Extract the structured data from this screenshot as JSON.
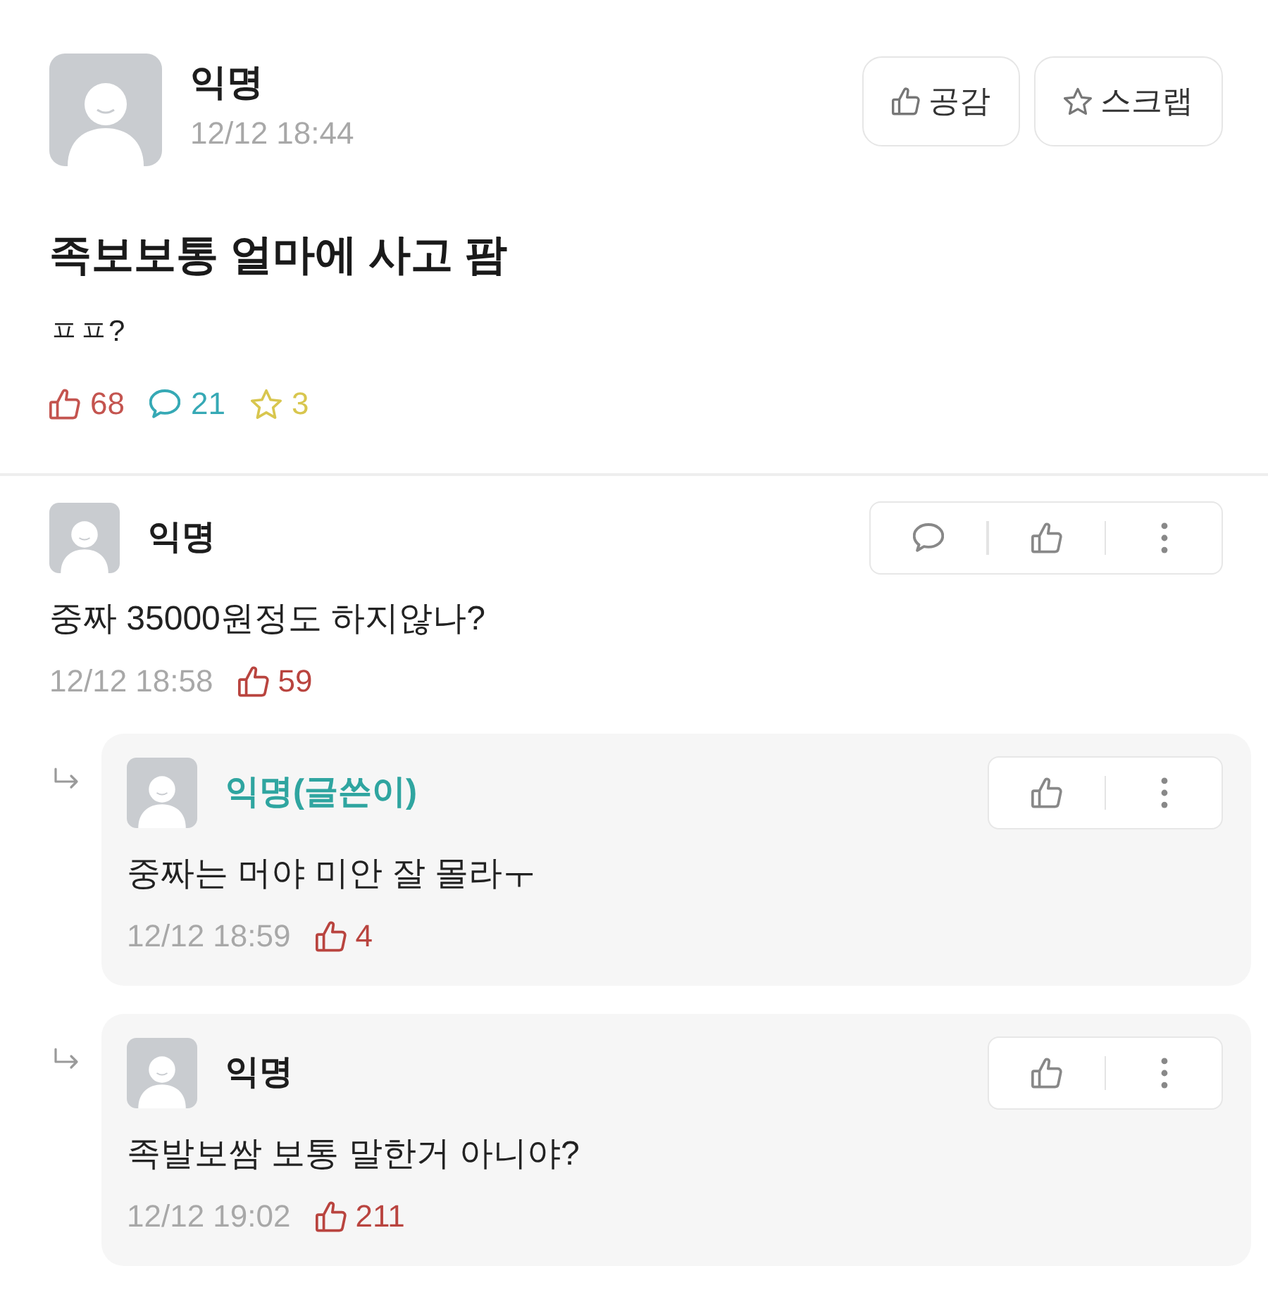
{
  "post": {
    "author": "익명",
    "time": "12/12 18:44",
    "buttons": [
      {
        "kind": "like",
        "label": "공감"
      },
      {
        "kind": "scrap",
        "label": "스크랩"
      }
    ],
    "title": "족보보통 얼마에 사고 팜",
    "body": "ㅍㅍ?",
    "stats": [
      {
        "kind": "like",
        "count": "68",
        "color": "#c4544f"
      },
      {
        "kind": "comment",
        "count": "21",
        "color": "#36a9b5"
      },
      {
        "kind": "scrap",
        "count": "3",
        "color": "#d8c64e"
      }
    ]
  },
  "comments": [
    {
      "author": "익명",
      "is_writer": false,
      "actions": [
        {
          "kind": "comment"
        },
        {
          "kind": "like"
        },
        {
          "kind": "more"
        }
      ],
      "text": "중짜 35000원정도 하지않나?",
      "time": "12/12 18:58",
      "likes": "59",
      "replies": [
        {
          "author": "익명(글쓴이)",
          "is_writer": true,
          "actions": [
            {
              "kind": "like"
            },
            {
              "kind": "more"
            }
          ],
          "text": "중짜는 머야 미안 잘 몰라ㅜ",
          "time": "12/12 18:59",
          "likes": "4"
        },
        {
          "author": "익명",
          "is_writer": false,
          "actions": [
            {
              "kind": "like"
            },
            {
              "kind": "more"
            }
          ],
          "text": "족발보쌈 보통 말한거 아니야?",
          "time": "12/12 19:02",
          "likes": "211"
        }
      ]
    }
  ]
}
